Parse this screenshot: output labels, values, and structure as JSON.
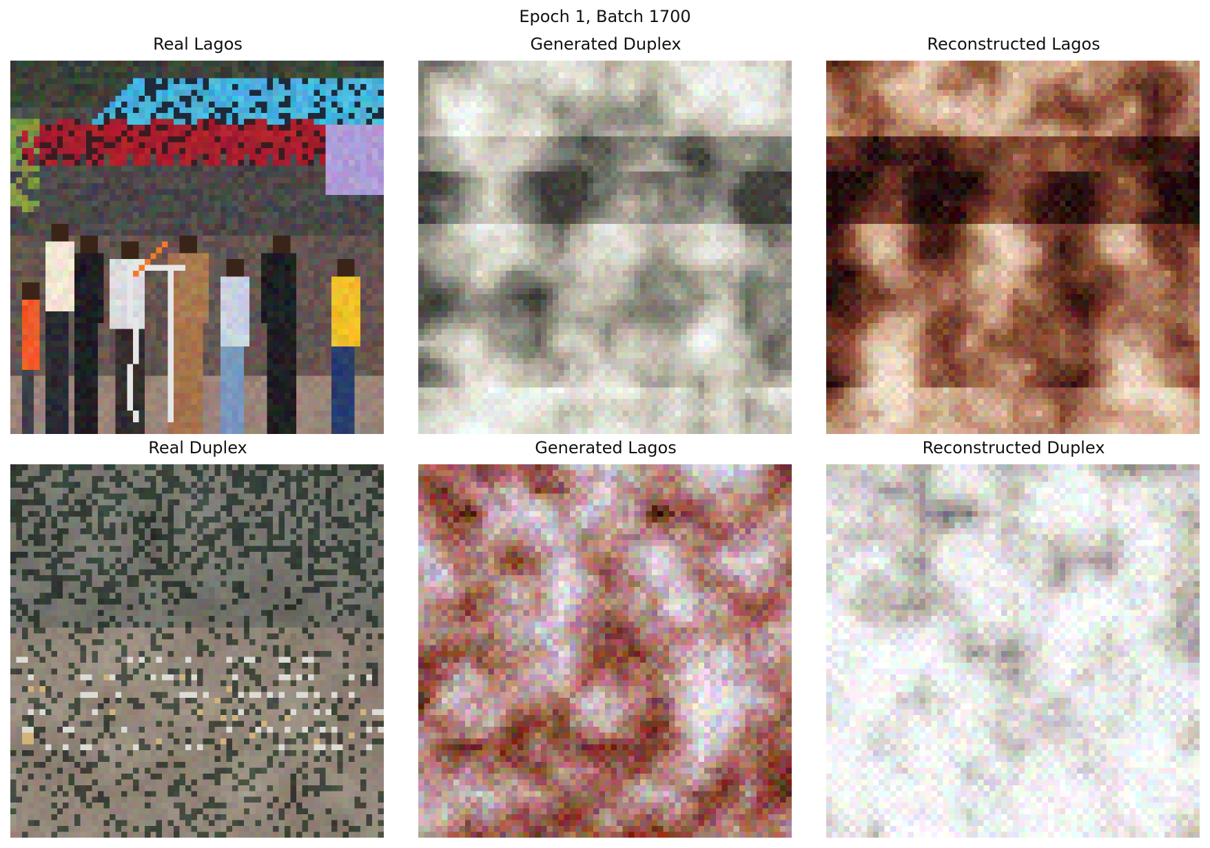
{
  "figure": {
    "suptitle": "Epoch 1, Batch 1700"
  },
  "panels": [
    {
      "title": "Real Lagos",
      "content": "photo-crowd-street-scene"
    },
    {
      "title": "Generated Duplex",
      "content": "generated-blurry-crowd-light-tones"
    },
    {
      "title": "Reconstructed Lagos",
      "content": "reconstructed-crowd-dark-brown-tones"
    },
    {
      "title": "Real Duplex",
      "content": "photo-aerial-hillside-village"
    },
    {
      "title": "Generated Lagos",
      "content": "generated-noisy-red-brown-texture"
    },
    {
      "title": "Reconstructed Duplex",
      "content": "reconstructed-washed-out-white-texture"
    }
  ]
}
